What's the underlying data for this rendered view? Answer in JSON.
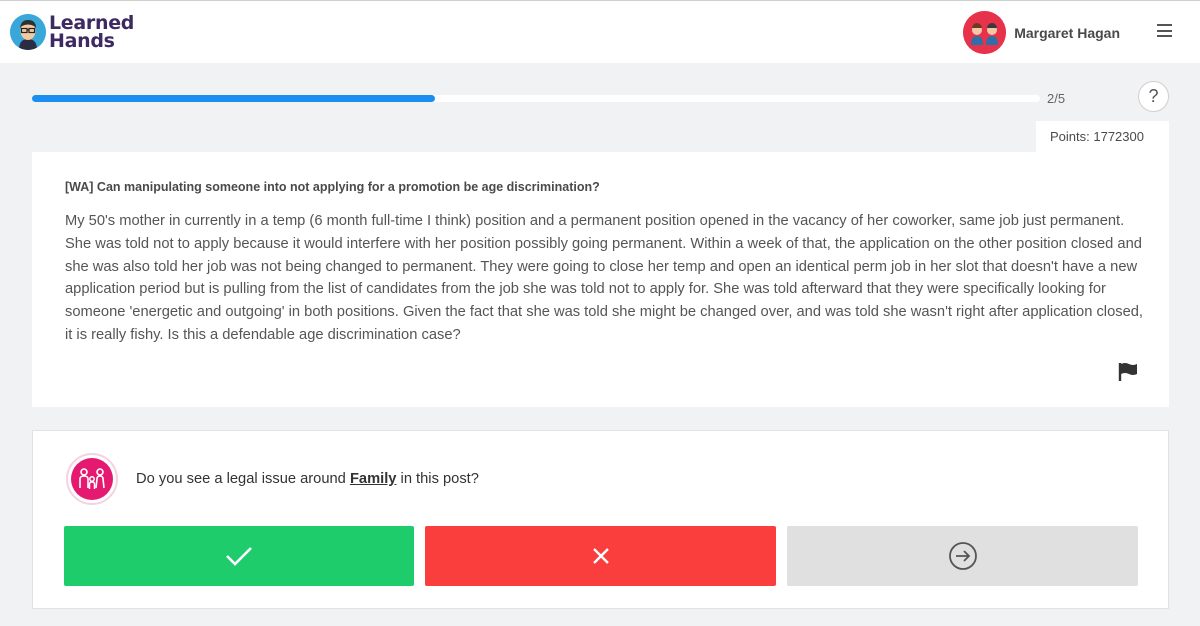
{
  "app": {
    "logo_text_line1": "Learned",
    "logo_text_line2": "Hands"
  },
  "user": {
    "name": "Margaret Hagan"
  },
  "progress": {
    "current": 2,
    "total": 5,
    "label": "2/5",
    "fraction": 0.4
  },
  "help_label": "?",
  "points": {
    "label": "Points: 1772300"
  },
  "post": {
    "title": "[WA] Can manipulating someone into not applying for a promotion be age discrimination?",
    "body": "My 50's mother in currently in a temp (6 month full-time I think) position and a permanent position opened in the vacancy of her coworker, same job just permanent.  She was told not to apply because it would interfere with her position possibly going permanent. Within a week of that, the application on the other position closed and she was also told her job was not being changed to permanent. They were going to close her temp and open an identical perm job in her slot that doesn't have a new application period but is pulling from the list of candidates from the job she was told not to apply for. She was told afterward that they were specifically looking for someone 'energetic and outgoing' in both positions. Given the fact that she was told she might be changed over, and was told she wasn't right after application closed, it is really fishy. Is this a defendable age discrimination case?"
  },
  "question": {
    "prefix": "Do you see a legal issue around ",
    "topic": "Family",
    "suffix": " in this post?",
    "icon": "family-icon"
  },
  "buttons": {
    "yes_icon": "checkmark-icon",
    "no_icon": "x-icon",
    "skip_icon": "arrow-right-circle-icon"
  },
  "colors": {
    "progress": "#1c8ef0",
    "yes": "#1fcc6c",
    "no": "#fa3e3e",
    "skip": "#e0e0e0",
    "topic_icon_bg": "#e5196f",
    "logo_text": "#3d2a62"
  }
}
